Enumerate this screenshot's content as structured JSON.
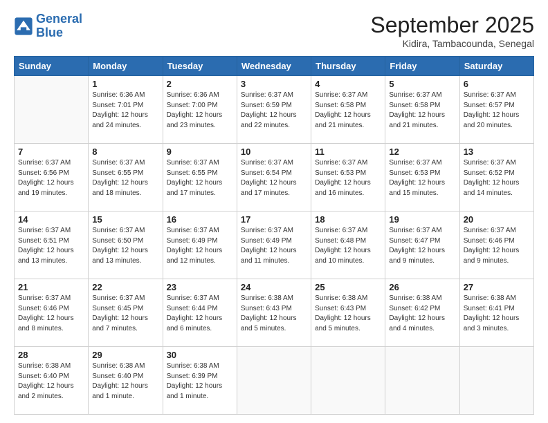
{
  "logo": {
    "line1": "General",
    "line2": "Blue"
  },
  "title": "September 2025",
  "subtitle": "Kidira, Tambacounda, Senegal",
  "days": [
    "Sunday",
    "Monday",
    "Tuesday",
    "Wednesday",
    "Thursday",
    "Friday",
    "Saturday"
  ],
  "weeks": [
    [
      {
        "day": "",
        "info": ""
      },
      {
        "day": "1",
        "info": "Sunrise: 6:36 AM\nSunset: 7:01 PM\nDaylight: 12 hours\nand 24 minutes."
      },
      {
        "day": "2",
        "info": "Sunrise: 6:36 AM\nSunset: 7:00 PM\nDaylight: 12 hours\nand 23 minutes."
      },
      {
        "day": "3",
        "info": "Sunrise: 6:37 AM\nSunset: 6:59 PM\nDaylight: 12 hours\nand 22 minutes."
      },
      {
        "day": "4",
        "info": "Sunrise: 6:37 AM\nSunset: 6:58 PM\nDaylight: 12 hours\nand 21 minutes."
      },
      {
        "day": "5",
        "info": "Sunrise: 6:37 AM\nSunset: 6:58 PM\nDaylight: 12 hours\nand 21 minutes."
      },
      {
        "day": "6",
        "info": "Sunrise: 6:37 AM\nSunset: 6:57 PM\nDaylight: 12 hours\nand 20 minutes."
      }
    ],
    [
      {
        "day": "7",
        "info": "Sunrise: 6:37 AM\nSunset: 6:56 PM\nDaylight: 12 hours\nand 19 minutes."
      },
      {
        "day": "8",
        "info": "Sunrise: 6:37 AM\nSunset: 6:55 PM\nDaylight: 12 hours\nand 18 minutes."
      },
      {
        "day": "9",
        "info": "Sunrise: 6:37 AM\nSunset: 6:55 PM\nDaylight: 12 hours\nand 17 minutes."
      },
      {
        "day": "10",
        "info": "Sunrise: 6:37 AM\nSunset: 6:54 PM\nDaylight: 12 hours\nand 17 minutes."
      },
      {
        "day": "11",
        "info": "Sunrise: 6:37 AM\nSunset: 6:53 PM\nDaylight: 12 hours\nand 16 minutes."
      },
      {
        "day": "12",
        "info": "Sunrise: 6:37 AM\nSunset: 6:53 PM\nDaylight: 12 hours\nand 15 minutes."
      },
      {
        "day": "13",
        "info": "Sunrise: 6:37 AM\nSunset: 6:52 PM\nDaylight: 12 hours\nand 14 minutes."
      }
    ],
    [
      {
        "day": "14",
        "info": "Sunrise: 6:37 AM\nSunset: 6:51 PM\nDaylight: 12 hours\nand 13 minutes."
      },
      {
        "day": "15",
        "info": "Sunrise: 6:37 AM\nSunset: 6:50 PM\nDaylight: 12 hours\nand 13 minutes."
      },
      {
        "day": "16",
        "info": "Sunrise: 6:37 AM\nSunset: 6:49 PM\nDaylight: 12 hours\nand 12 minutes."
      },
      {
        "day": "17",
        "info": "Sunrise: 6:37 AM\nSunset: 6:49 PM\nDaylight: 12 hours\nand 11 minutes."
      },
      {
        "day": "18",
        "info": "Sunrise: 6:37 AM\nSunset: 6:48 PM\nDaylight: 12 hours\nand 10 minutes."
      },
      {
        "day": "19",
        "info": "Sunrise: 6:37 AM\nSunset: 6:47 PM\nDaylight: 12 hours\nand 9 minutes."
      },
      {
        "day": "20",
        "info": "Sunrise: 6:37 AM\nSunset: 6:46 PM\nDaylight: 12 hours\nand 9 minutes."
      }
    ],
    [
      {
        "day": "21",
        "info": "Sunrise: 6:37 AM\nSunset: 6:46 PM\nDaylight: 12 hours\nand 8 minutes."
      },
      {
        "day": "22",
        "info": "Sunrise: 6:37 AM\nSunset: 6:45 PM\nDaylight: 12 hours\nand 7 minutes."
      },
      {
        "day": "23",
        "info": "Sunrise: 6:37 AM\nSunset: 6:44 PM\nDaylight: 12 hours\nand 6 minutes."
      },
      {
        "day": "24",
        "info": "Sunrise: 6:38 AM\nSunset: 6:43 PM\nDaylight: 12 hours\nand 5 minutes."
      },
      {
        "day": "25",
        "info": "Sunrise: 6:38 AM\nSunset: 6:43 PM\nDaylight: 12 hours\nand 5 minutes."
      },
      {
        "day": "26",
        "info": "Sunrise: 6:38 AM\nSunset: 6:42 PM\nDaylight: 12 hours\nand 4 minutes."
      },
      {
        "day": "27",
        "info": "Sunrise: 6:38 AM\nSunset: 6:41 PM\nDaylight: 12 hours\nand 3 minutes."
      }
    ],
    [
      {
        "day": "28",
        "info": "Sunrise: 6:38 AM\nSunset: 6:40 PM\nDaylight: 12 hours\nand 2 minutes."
      },
      {
        "day": "29",
        "info": "Sunrise: 6:38 AM\nSunset: 6:40 PM\nDaylight: 12 hours\nand 1 minute."
      },
      {
        "day": "30",
        "info": "Sunrise: 6:38 AM\nSunset: 6:39 PM\nDaylight: 12 hours\nand 1 minute."
      },
      {
        "day": "",
        "info": ""
      },
      {
        "day": "",
        "info": ""
      },
      {
        "day": "",
        "info": ""
      },
      {
        "day": "",
        "info": ""
      }
    ]
  ]
}
